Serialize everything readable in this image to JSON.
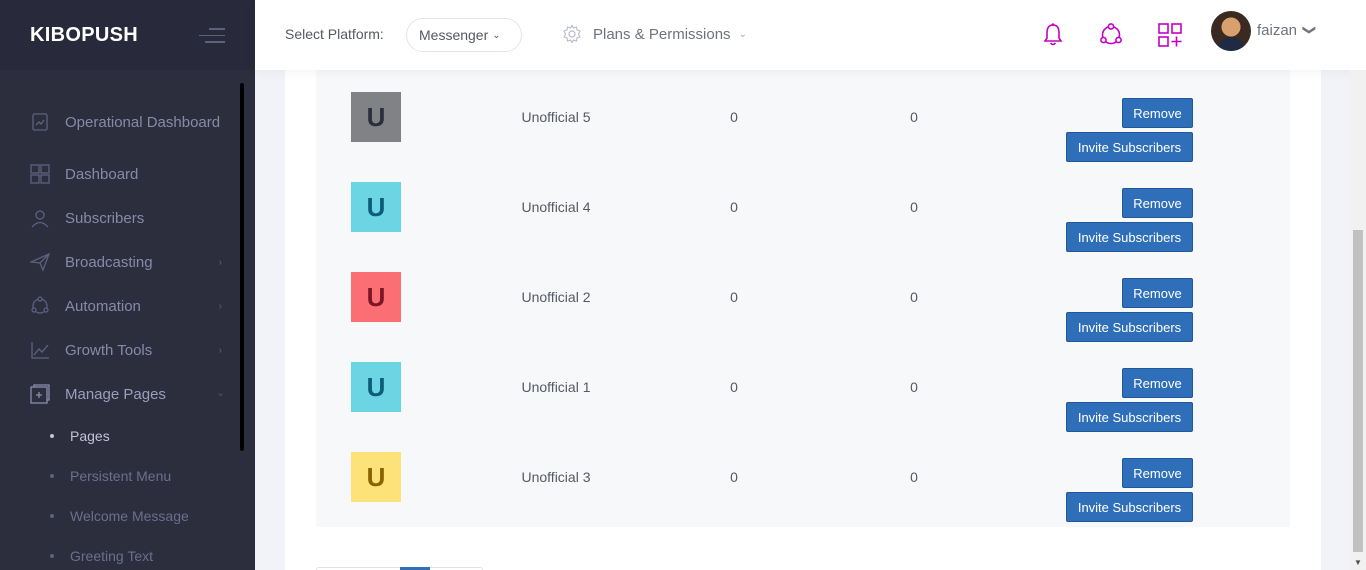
{
  "app": {
    "brand": "KIBOPUSH"
  },
  "sidebar": {
    "items": [
      {
        "label": "Operational Dashboard",
        "icon": "operational-dashboard-icon",
        "has_submenu": false
      },
      {
        "label": "Dashboard",
        "icon": "dashboard-grid-icon",
        "has_submenu": false
      },
      {
        "label": "Subscribers",
        "icon": "subscribers-icon",
        "has_submenu": false
      },
      {
        "label": "Broadcasting",
        "icon": "paper-plane-icon",
        "has_submenu": true
      },
      {
        "label": "Automation",
        "icon": "automation-icon",
        "has_submenu": true
      },
      {
        "label": "Growth Tools",
        "icon": "growth-chart-icon",
        "has_submenu": true
      },
      {
        "label": "Manage Pages",
        "icon": "manage-pages-icon",
        "has_submenu": true,
        "expanded": true
      }
    ],
    "subitems": [
      {
        "label": "Pages",
        "active": true
      },
      {
        "label": "Persistent Menu",
        "active": false
      },
      {
        "label": "Welcome Message",
        "active": false
      },
      {
        "label": "Greeting Text",
        "active": false
      }
    ]
  },
  "header": {
    "platform_label": "Select Platform:",
    "platform_value": "Messenger",
    "plans_label": "Plans & Permissions",
    "username": "faizan",
    "accent_color": "#c400c4"
  },
  "rows": [
    {
      "letter": "U",
      "name": "Unofficial 5",
      "col1": "0",
      "col2": "0",
      "bg": "#808285",
      "fg": "#2c2e3e"
    },
    {
      "letter": "U",
      "name": "Unofficial 4",
      "col1": "0",
      "col2": "0",
      "bg": "#6bd5e3",
      "fg": "#0e5c7a"
    },
    {
      "letter": "U",
      "name": "Unofficial 2",
      "col1": "0",
      "col2": "0",
      "bg": "#fb6f74",
      "fg": "#7b1626"
    },
    {
      "letter": "U",
      "name": "Unofficial 1",
      "col1": "0",
      "col2": "0",
      "bg": "#6bd5e3",
      "fg": "#0e5c7a"
    },
    {
      "letter": "U",
      "name": "Unofficial 3",
      "col1": "0",
      "col2": "0",
      "bg": "#fde27a",
      "fg": "#8a6200"
    }
  ],
  "buttons": {
    "remove": "Remove",
    "invite": "Invite Subscribers"
  }
}
